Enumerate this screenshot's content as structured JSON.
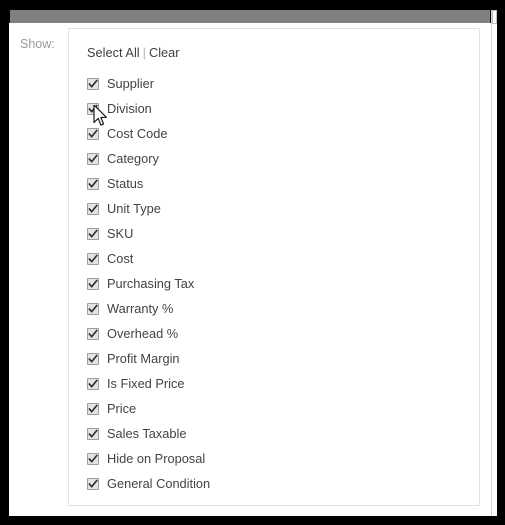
{
  "window": {
    "frame_color": "#000000",
    "titlebar_color": "#808080"
  },
  "form": {
    "show_label": "Show:"
  },
  "panel": {
    "bulk_actions": {
      "select_all_label": "Select All",
      "separator": "|",
      "clear_label": "Clear"
    },
    "items": [
      {
        "label": "Supplier",
        "checked": true
      },
      {
        "label": "Division",
        "checked": true
      },
      {
        "label": "Cost Code",
        "checked": true
      },
      {
        "label": "Category",
        "checked": true
      },
      {
        "label": "Status",
        "checked": true
      },
      {
        "label": "Unit Type",
        "checked": true
      },
      {
        "label": "SKU",
        "checked": true
      },
      {
        "label": "Cost",
        "checked": true
      },
      {
        "label": "Purchasing Tax",
        "checked": true
      },
      {
        "label": "Warranty %",
        "checked": true
      },
      {
        "label": "Overhead %",
        "checked": true
      },
      {
        "label": "Profit Margin",
        "checked": true
      },
      {
        "label": "Is Fixed Price",
        "checked": true
      },
      {
        "label": "Price",
        "checked": true
      },
      {
        "label": "Sales Taxable",
        "checked": true
      },
      {
        "label": "Hide on Proposal",
        "checked": true
      },
      {
        "label": "General Condition",
        "checked": true
      }
    ]
  },
  "cursor": {
    "icon": "arrow-pointer-icon"
  }
}
